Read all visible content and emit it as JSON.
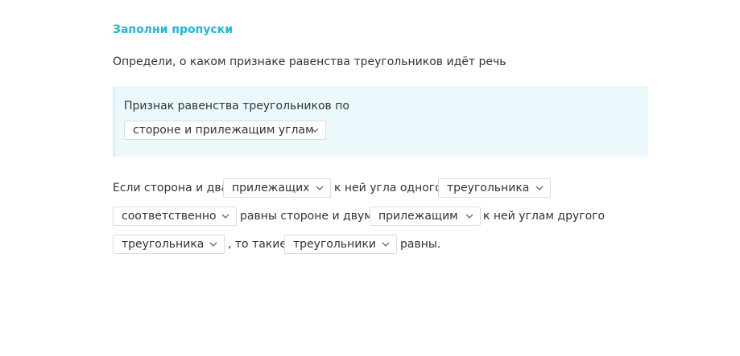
{
  "task": {
    "title": "Заполни пропуски",
    "instruction": "Определи, о каком признаке равенства треугольников идёт речь"
  },
  "hint": {
    "prefix": "Признак равенства треугольников по",
    "selected": "стороне и прилежащим углам"
  },
  "sentence": {
    "t1": "Если сторона и два",
    "d1": "прилежащих",
    "t2": "к ней угла одного",
    "d2": "треугольника",
    "d3": "соответственно",
    "t3": "равны стороне и двум",
    "d4": "прилежащим",
    "t4": "к ней углам другого",
    "d5": "треугольника",
    "t5": ", то такие",
    "d6": "треугольники",
    "t6": "равны."
  },
  "icons": {
    "dropdown_chevron": "chevron-down-icon"
  },
  "colors": {
    "accent": "#1fb6dc",
    "hint_background": "#ebf9fd",
    "text": "#333333",
    "dropdown_border": "#dcdcdc"
  }
}
